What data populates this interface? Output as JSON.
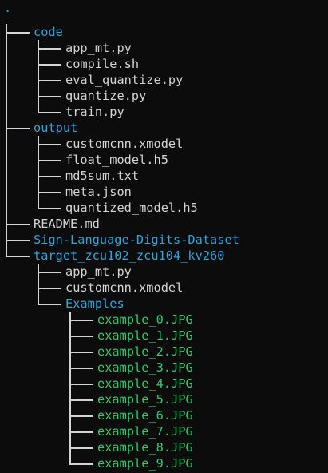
{
  "terminal": {
    "root": ".",
    "colors": {
      "background": "#0c0c0c",
      "directory": "#29a7e1",
      "file": "#d4d4d4",
      "image": "#2ecc71"
    },
    "tree": [
      {
        "name": "code",
        "type": "dir",
        "depth": 0,
        "last": false,
        "ancestors_continue": []
      },
      {
        "name": "app_mt.py",
        "type": "file",
        "depth": 1,
        "last": false,
        "ancestors_continue": [
          true
        ]
      },
      {
        "name": "compile.sh",
        "type": "file",
        "depth": 1,
        "last": false,
        "ancestors_continue": [
          true
        ]
      },
      {
        "name": "eval_quantize.py",
        "type": "file",
        "depth": 1,
        "last": false,
        "ancestors_continue": [
          true
        ]
      },
      {
        "name": "quantize.py",
        "type": "file",
        "depth": 1,
        "last": false,
        "ancestors_continue": [
          true
        ]
      },
      {
        "name": "train.py",
        "type": "file",
        "depth": 1,
        "last": true,
        "ancestors_continue": [
          true
        ]
      },
      {
        "name": "output",
        "type": "dir",
        "depth": 0,
        "last": false,
        "ancestors_continue": []
      },
      {
        "name": "customcnn.xmodel",
        "type": "file",
        "depth": 1,
        "last": false,
        "ancestors_continue": [
          true
        ]
      },
      {
        "name": "float_model.h5",
        "type": "file",
        "depth": 1,
        "last": false,
        "ancestors_continue": [
          true
        ]
      },
      {
        "name": "md5sum.txt",
        "type": "file",
        "depth": 1,
        "last": false,
        "ancestors_continue": [
          true
        ]
      },
      {
        "name": "meta.json",
        "type": "file",
        "depth": 1,
        "last": false,
        "ancestors_continue": [
          true
        ]
      },
      {
        "name": "quantized_model.h5",
        "type": "file",
        "depth": 1,
        "last": true,
        "ancestors_continue": [
          true
        ]
      },
      {
        "name": "README.md",
        "type": "file",
        "depth": 0,
        "last": false,
        "ancestors_continue": []
      },
      {
        "name": "Sign-Language-Digits-Dataset",
        "type": "dir",
        "depth": 0,
        "last": false,
        "ancestors_continue": []
      },
      {
        "name": "target_zcu102_zcu104_kv260",
        "type": "dir",
        "depth": 0,
        "last": true,
        "ancestors_continue": []
      },
      {
        "name": "app_mt.py",
        "type": "file",
        "depth": 1,
        "last": false,
        "ancestors_continue": [
          false
        ]
      },
      {
        "name": "customcnn.xmodel",
        "type": "file",
        "depth": 1,
        "last": false,
        "ancestors_continue": [
          false
        ]
      },
      {
        "name": "Examples",
        "type": "dir",
        "depth": 1,
        "last": true,
        "ancestors_continue": [
          false
        ]
      },
      {
        "name": "example_0.JPG",
        "type": "img",
        "depth": 2,
        "last": false,
        "ancestors_continue": [
          false,
          false
        ]
      },
      {
        "name": "example_1.JPG",
        "type": "img",
        "depth": 2,
        "last": false,
        "ancestors_continue": [
          false,
          false
        ]
      },
      {
        "name": "example_2.JPG",
        "type": "img",
        "depth": 2,
        "last": false,
        "ancestors_continue": [
          false,
          false
        ]
      },
      {
        "name": "example_3.JPG",
        "type": "img",
        "depth": 2,
        "last": false,
        "ancestors_continue": [
          false,
          false
        ]
      },
      {
        "name": "example_4.JPG",
        "type": "img",
        "depth": 2,
        "last": false,
        "ancestors_continue": [
          false,
          false
        ]
      },
      {
        "name": "example_5.JPG",
        "type": "img",
        "depth": 2,
        "last": false,
        "ancestors_continue": [
          false,
          false
        ]
      },
      {
        "name": "example_6.JPG",
        "type": "img",
        "depth": 2,
        "last": false,
        "ancestors_continue": [
          false,
          false
        ]
      },
      {
        "name": "example_7.JPG",
        "type": "img",
        "depth": 2,
        "last": false,
        "ancestors_continue": [
          false,
          false
        ]
      },
      {
        "name": "example_8.JPG",
        "type": "img",
        "depth": 2,
        "last": false,
        "ancestors_continue": [
          false,
          false
        ]
      },
      {
        "name": "example_9.JPG",
        "type": "img",
        "depth": 2,
        "last": true,
        "ancestors_continue": [
          false,
          false
        ]
      }
    ]
  }
}
